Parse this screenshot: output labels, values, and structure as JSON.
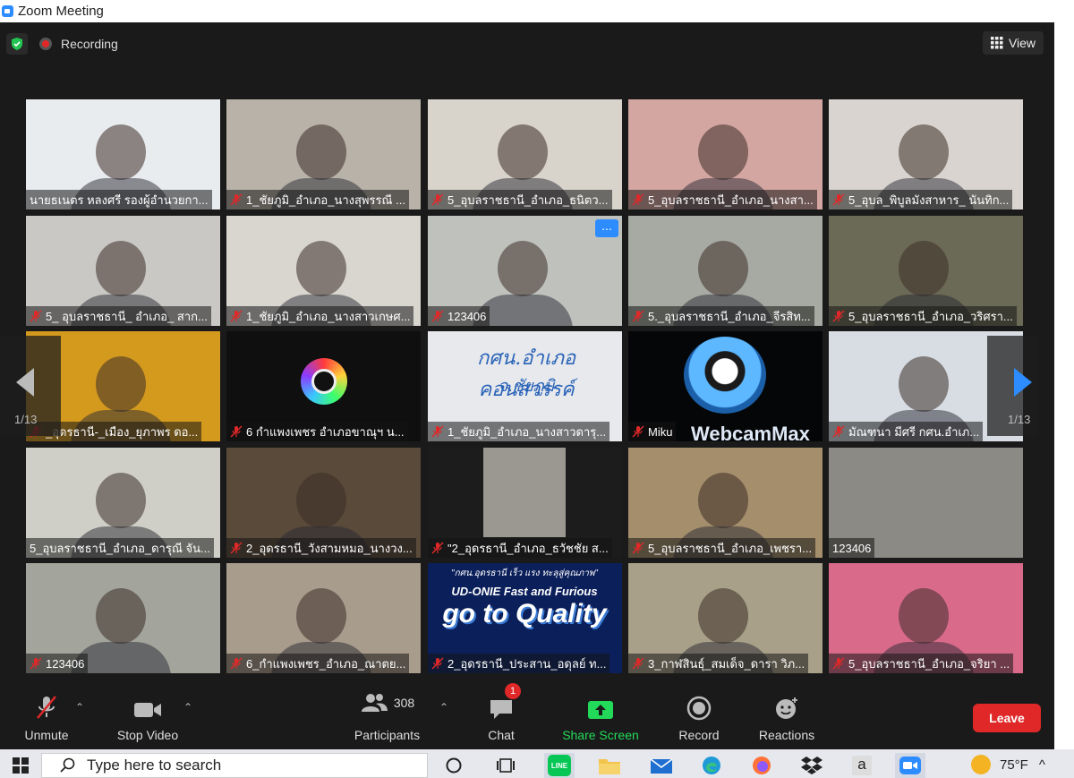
{
  "window": {
    "title": "Zoom Meeting"
  },
  "topbar": {
    "recording_label": "Recording",
    "view_label": "View"
  },
  "tiles": [
    {
      "name": "นายธเนตร หลงศรี รองผู้อำนวยกา...",
      "muted": false,
      "bg": "#e9ecef"
    },
    {
      "name": "1_ชัยภูมิ_อำเภอ_นางสุพรรณี ...",
      "muted": true,
      "bg": "#b8b2a8"
    },
    {
      "name": "5_อุบลราชธานี_อำเภอ_ธนิตว...",
      "muted": true,
      "bg": "#d8d3cb"
    },
    {
      "name": "5_อุบลราชธานี_อำเภอ_นางสา...",
      "muted": true,
      "bg": "#d4a6a2"
    },
    {
      "name": "5_อุบล_พิบูลมังสาหาร_ นันทิก...",
      "muted": true,
      "bg": "#d9d4cf"
    },
    {
      "name": "5_ อุบลราชธานี_ อำเภอ_ สาก...",
      "muted": true,
      "bg": "#c9c8c4"
    },
    {
      "name": "1_ชัยภูมิ_อำเภอ_นางสาวเกษศ...",
      "muted": true,
      "bg": "#d9d6d0"
    },
    {
      "name": "123406",
      "muted": true,
      "bg": "#bfc1bd"
    },
    {
      "name": "5._อุบลราชธานี_อำเภอ_จีรสิท...",
      "muted": true,
      "bg": "#a6aaa2"
    },
    {
      "name": "5_อุบลราชธานี_อำเภอ_วริศรา...",
      "muted": true,
      "bg": "#6b6a56"
    },
    {
      "name": "_อุดรธานี-_เมือง_ยุภาพร ดอ...",
      "muted": true,
      "bg": "#d49a1e"
    },
    {
      "name": "6 กำแพงเพชร อำเภอขาณุฯ น...",
      "muted": true,
      "bg": "#0f0f0f"
    },
    {
      "name": "1_ชัยภูมิ_อำเภอ_นางสาวดารุ...",
      "muted": true,
      "bg": "#e7e9ec"
    },
    {
      "name": "Miku",
      "muted": true,
      "bg": "#050608"
    },
    {
      "name": "มัณฑนา มีศรี กศน.อำเภ...",
      "muted": true,
      "bg": "#d8dde4"
    },
    {
      "name": "5_อุบลราชธานี_อำเภอ_ดารุณี จัน...",
      "muted": false,
      "bg": "#cfcfc7"
    },
    {
      "name": "2_อุดรธานี_วังสามหมอ_นางวง...",
      "muted": true,
      "bg": "#5a4a3a"
    },
    {
      "name": "\"2_อุดรธานี_อำเภอ_ธวัชชัย ส...",
      "muted": true,
      "bg": "#1c1c1c"
    },
    {
      "name": "5_อุบลราชธานี_อำเภอ_เพชรา...",
      "muted": true,
      "bg": "#a58e6c"
    },
    {
      "name": "123406",
      "muted": false,
      "bg": "#8c8a84"
    },
    {
      "name": "123406",
      "muted": true,
      "bg": "#a3a49c"
    },
    {
      "name": "6_กำแพงเพชร_อำเภอ_ณาตย...",
      "muted": true,
      "bg": "#a89c8c"
    },
    {
      "name": "2_อุดรธานี_ประสาน_อดุลย์ ท...",
      "muted": true,
      "bg": "#0b1f5a"
    },
    {
      "name": "3_กาฬสินธุ์_สมเด็จ_ดารา วิภ...",
      "muted": true,
      "bg": "#a8a088"
    },
    {
      "name": "5_อุบลราชธานี_อำเภอ_จริยา ...",
      "muted": true,
      "bg": "#d96a8a"
    }
  ],
  "tile_texts": {
    "khon_sawan": "กศน.อำเภอคอนสวรรค์",
    "chaiyaphum": "จ.ชัยภูมิ",
    "banner_top": "\"กศน.อุดรธานี เร็ว แรง ทะลุสู่คุณภาพ\"",
    "banner_mid": "UD-ONIE Fast and Furious",
    "banner_big": "go to Quality",
    "webcam": "WebcamMax"
  },
  "pagination": {
    "left": "1/13",
    "right": "1/13"
  },
  "toolbar": {
    "unmute": "Unmute",
    "stop_video": "Stop Video",
    "participants_count": "308",
    "participants": "Participants",
    "chat": "Chat",
    "chat_badge": "1",
    "share_screen": "Share Screen",
    "record": "Record",
    "reactions": "Reactions",
    "leave": "Leave"
  },
  "taskbar": {
    "search_placeholder": "Type here to search",
    "temperature": "75°F"
  },
  "colors": {
    "accent_blue": "#2d8cff",
    "leave_red": "#e02828",
    "share_green": "#23d959",
    "active_speaker": "#e4f06a"
  }
}
